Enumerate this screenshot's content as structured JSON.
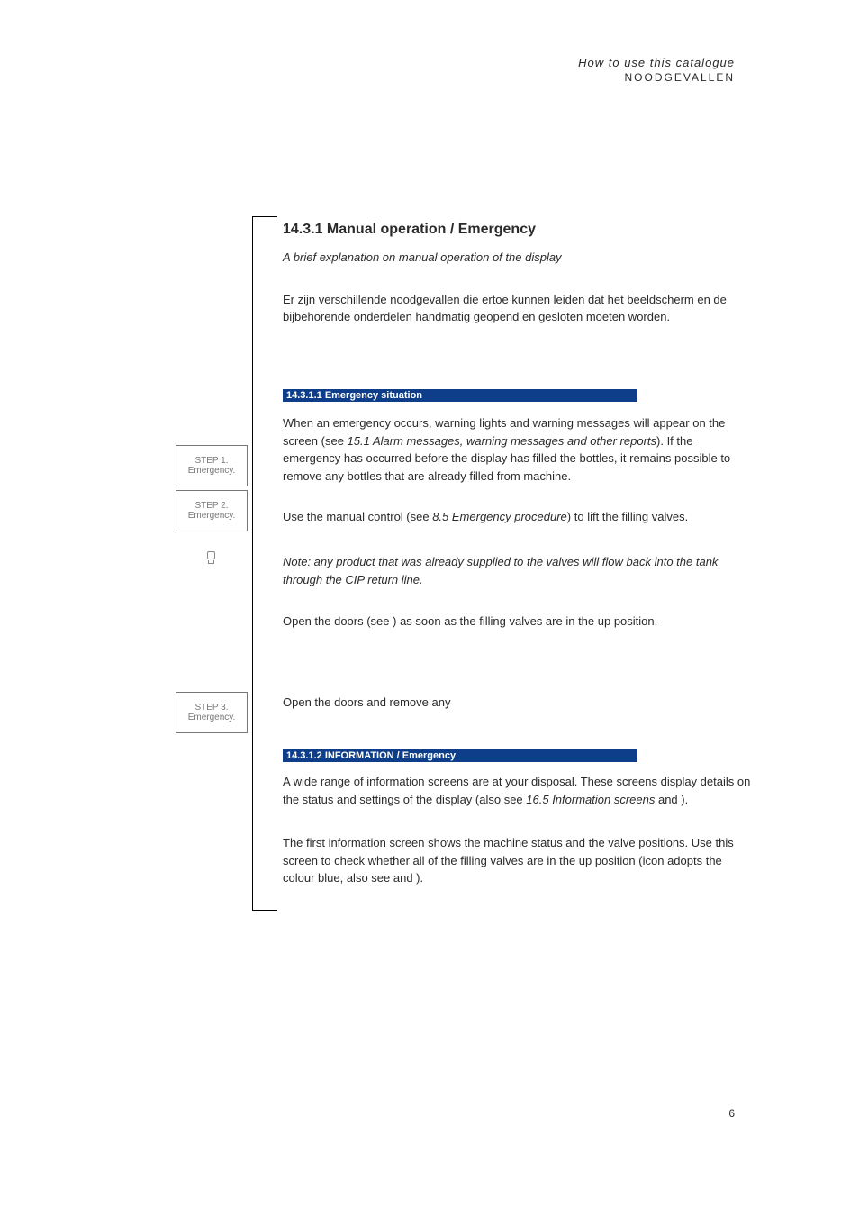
{
  "header": {
    "line1": "How to use this catalogue",
    "line2": "NOODGEVALLEN"
  },
  "section": {
    "title": "14.3.1 Manual operation / Emergency",
    "subtitle": "A brief explanation on manual operation of the display",
    "intro": "Er zijn verschillende noodgevallen die ertoe kunnen leiden dat het beeldscherm en de bijbehorende onderdelen handmatig geopend en gesloten moeten worden."
  },
  "bars": {
    "emergency": "14.3.1.1 Emergency situation",
    "information": "14.3.1.2 INFORMATION / Emergency"
  },
  "steps": {
    "step1_line1": "STEP 1.",
    "step1_line2": "Emergency.",
    "step2_line1": "STEP 2.",
    "step2_line2": "Emergency.",
    "step3_line1": "STEP 3.",
    "step3_line2": "Emergency."
  },
  "paragraphs": {
    "p1_a": "When an emergency occurs, warning lights and warning messages will appear on the screen (see ",
    "p1_a_em": "15.1 Alarm messages, warning messages and other reports",
    "p1_b": "). If the emergency has occurred before the display has filled the bottles, it remains possible to remove any bottles that are already filled from machine.",
    "p2_a": "Use the manual control (see ",
    "p2_a_em": "8.5 Emergency procedure",
    "p2_b": ") to lift the filling valves.",
    "p3": "Note: any product that was already supplied to the valves will flow back into the tank through the CIP return line.",
    "p4": "Open the doors (see  ) as soon as the filling valves are in the up position.",
    "p5": "Open the doors and remove any",
    "p6_a": "A wide range of information screens are at your disposal. These screens display details on the status and settings of the display (also see ",
    "p6_a_em": "16.5 Information screens",
    "p6_b": " and ).",
    "p7": "The first information screen shows the machine status and the valve positions. Use this screen to check whether all of the filling valves are in the up position (icon adopts the colour blue, also see and )."
  },
  "footer": {
    "page": "6"
  }
}
